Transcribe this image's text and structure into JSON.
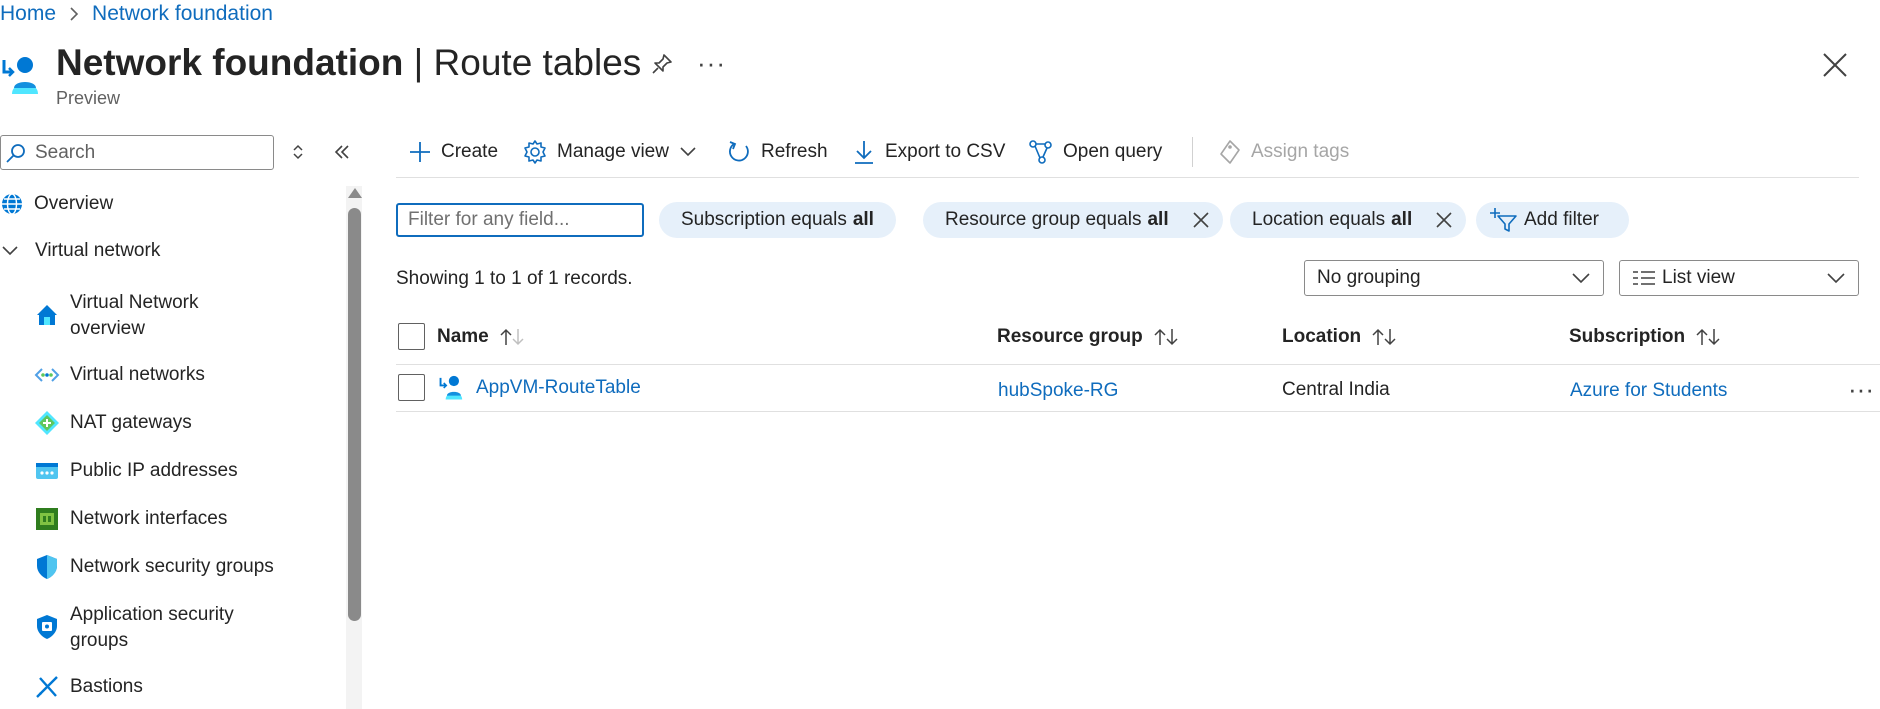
{
  "breadcrumb": {
    "home": "Home",
    "sep": ">",
    "current": "Network foundation"
  },
  "header": {
    "title_bold": "Network foundation",
    "title_rest": "| Route tables",
    "subtitle": "Preview",
    "more": "···"
  },
  "sidebar": {
    "search_placeholder": "Search",
    "items": [
      {
        "label": "Overview",
        "icon": "globe-icon"
      },
      {
        "label": "Virtual network",
        "icon": "chevron-down-icon"
      },
      {
        "label": "Virtual Network",
        "label2": "overview",
        "icon": "house-icon"
      },
      {
        "label": "Virtual networks",
        "icon": "vnet-icon"
      },
      {
        "label": "NAT gateways",
        "icon": "nat-gateway-icon"
      },
      {
        "label": "Public IP addresses",
        "icon": "public-ip-icon"
      },
      {
        "label": "Network interfaces",
        "icon": "nic-icon"
      },
      {
        "label": "Network security groups",
        "icon": "nsg-shield-icon"
      },
      {
        "label": "Application security",
        "label2": "groups",
        "icon": "asg-shield-icon"
      },
      {
        "label": "Bastions",
        "icon": "bastion-icon"
      }
    ]
  },
  "toolbar": {
    "create": "Create",
    "manage_view": "Manage view",
    "refresh": "Refresh",
    "export": "Export to CSV",
    "open_query": "Open query",
    "assign_tags": "Assign tags"
  },
  "filters": {
    "placeholder": "Filter for any field...",
    "pills": [
      {
        "prefix": "Subscription equals",
        "value": "all",
        "removable": false
      },
      {
        "prefix": "Resource group equals",
        "value": "all",
        "removable": true
      },
      {
        "prefix": "Location equals",
        "value": "all",
        "removable": true
      }
    ],
    "add_filter": "Add filter"
  },
  "records_text": "Showing 1 to 1 of 1 records.",
  "grouping": {
    "selected": "No grouping"
  },
  "view": {
    "selected": "List view"
  },
  "table": {
    "columns": [
      "Name",
      "Resource group",
      "Location",
      "Subscription"
    ],
    "rows": [
      {
        "name": "AppVM-RouteTable",
        "resource_group": "hubSpoke-RG",
        "location": "Central India",
        "subscription": "Azure for Students",
        "more": "···"
      }
    ]
  },
  "colors": {
    "accent": "#0f6cbd",
    "pill_bg": "#e6f0fa",
    "azure_blue": "#0078d4",
    "azure_cyan": "#50e6ff"
  }
}
